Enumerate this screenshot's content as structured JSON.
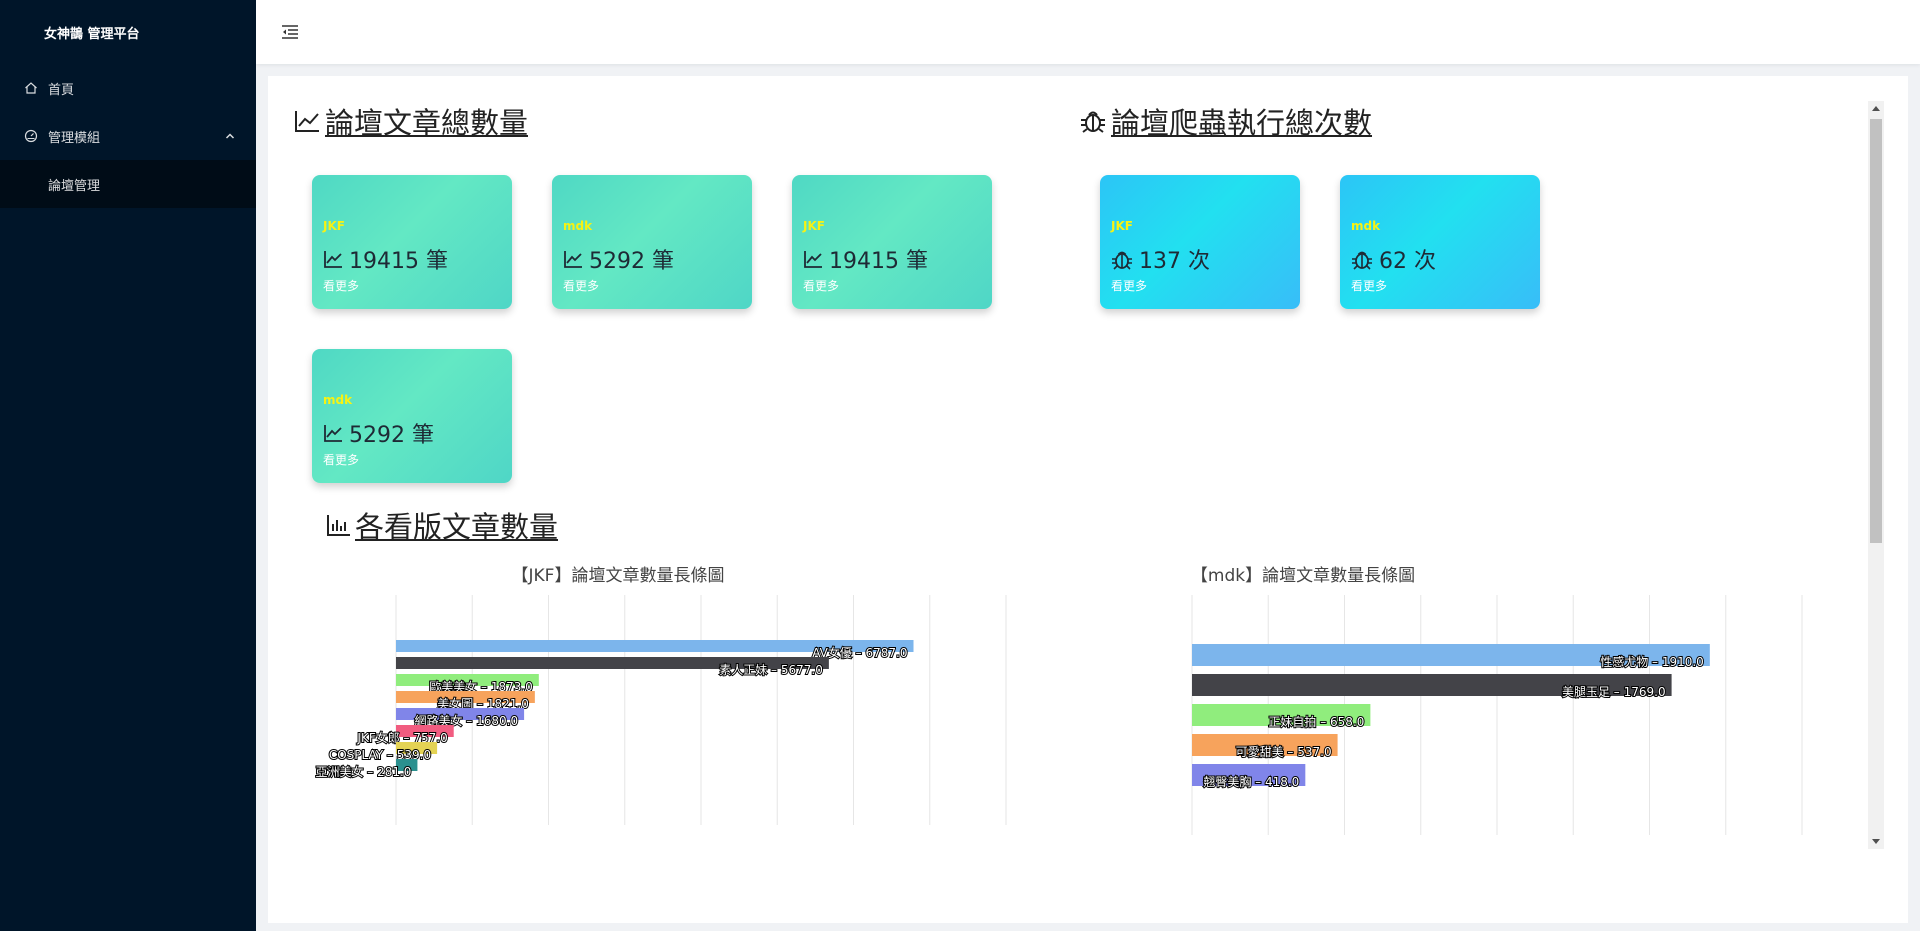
{
  "app": {
    "title": "女神鵲 管理平台"
  },
  "sidebar": {
    "items": [
      {
        "label": "首頁",
        "icon": "home-icon"
      },
      {
        "label": "管理模組",
        "icon": "dashboard-icon",
        "expanded": true,
        "children": [
          {
            "label": "論壇管理"
          }
        ]
      }
    ]
  },
  "section_articles": {
    "title": "論壇文章總數量",
    "cards": [
      {
        "name": "JKF",
        "value": "19415 筆",
        "more": "看更多"
      },
      {
        "name": "mdk",
        "value": "5292 筆",
        "more": "看更多"
      },
      {
        "name": "JKF",
        "value": "19415 筆",
        "more": "看更多"
      },
      {
        "name": "mdk",
        "value": "5292 筆",
        "more": "看更多"
      }
    ]
  },
  "section_crawler": {
    "title": "論壇爬蟲執行總次數",
    "cards": [
      {
        "name": "JKF",
        "value": "137 次",
        "more": "看更多"
      },
      {
        "name": "mdk",
        "value": "62 次",
        "more": "看更多"
      }
    ]
  },
  "section_boards": {
    "title": "各看版文章數量"
  },
  "colors": {
    "sidebar_bg": "#001529",
    "accent_green": "#5ee3c3",
    "accent_blue": "#2ccdf4",
    "card_name": "#f7f213"
  },
  "chart_data": [
    {
      "type": "bar",
      "orientation": "horizontal",
      "title": "【JKF】論壇文章數量長條圖",
      "categories": [
        "AV女優",
        "素人正妹",
        "歐美美女",
        "美女圖",
        "網路美女",
        "JKF女郎",
        "COSPLAY",
        "亞洲美女"
      ],
      "values": [
        6787.0,
        5677.0,
        1873.0,
        1821.0,
        1680.0,
        757.0,
        539.0,
        281.0
      ],
      "colors": [
        "#7cb5ec",
        "#434348",
        "#90ed7d",
        "#f7a35c",
        "#8085e9",
        "#f15c80",
        "#e4d354",
        "#2b908f"
      ],
      "xlim": [
        0,
        8000
      ],
      "grid": true
    },
    {
      "type": "bar",
      "orientation": "horizontal",
      "title": "【mdk】論壇文章數量長條圖",
      "categories": [
        "性感尤物",
        "美腿玉足",
        "正妹自拍",
        "可愛甜美",
        "翹臀美胸"
      ],
      "values": [
        1910.0,
        1769.0,
        658.0,
        537.0,
        418.0
      ],
      "colors": [
        "#7cb5ec",
        "#434348",
        "#90ed7d",
        "#f7a35c",
        "#8085e9"
      ],
      "xlim": [
        0,
        2250
      ],
      "grid": true
    }
  ]
}
